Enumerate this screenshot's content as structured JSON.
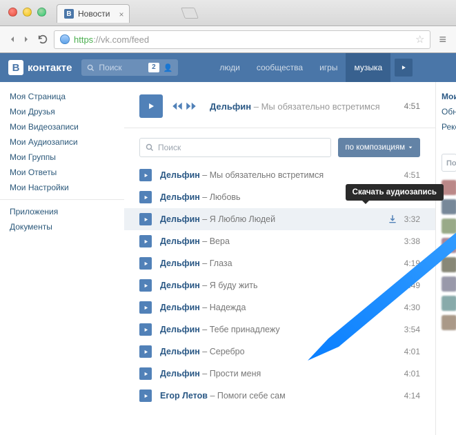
{
  "browser": {
    "tab_title": "Новости",
    "url_https": "https",
    "url_host": "://vk.com",
    "url_path": "/feed"
  },
  "vk": {
    "logo_text": "контакте",
    "search_placeholder": "Поиск",
    "search_badge": "2",
    "nav": [
      "люди",
      "сообщества",
      "игры",
      "музыка"
    ]
  },
  "leftnav": {
    "a": [
      "Моя Страница",
      "Мои Друзья",
      "Мои Видеозаписи",
      "Мои Аудиозаписи",
      "Мои Группы",
      "Мои Ответы",
      "Мои Настройки"
    ],
    "b": [
      "Приложения",
      "Документы"
    ]
  },
  "player": {
    "artist": "Дельфин",
    "title": "Мы обязательно встретимся",
    "duration": "4:51",
    "sep": " – "
  },
  "searchrow": {
    "placeholder": "Поиск",
    "button": "по композициям"
  },
  "tooltip": "Скачать аудиозапись",
  "rightpanel": {
    "tabs": "Мои ау",
    "l1": "Обновл",
    "l2": "Рекоме",
    "search": "Поиск"
  },
  "tracks": [
    {
      "artist": "Дельфин",
      "title": "Мы обязательно встретимся",
      "dur": "4:51"
    },
    {
      "artist": "Дельфин",
      "title": "Любовь",
      "dur": ""
    },
    {
      "artist": "Дельфин",
      "title": "Я Люблю Людей",
      "dur": "3:32",
      "highlight": true,
      "download": true
    },
    {
      "artist": "Дельфин",
      "title": "Вера",
      "dur": "3:38"
    },
    {
      "artist": "Дельфин",
      "title": "Глаза",
      "dur": "4:19"
    },
    {
      "artist": "Дельфин",
      "title": "Я буду жить",
      "dur": "3:49"
    },
    {
      "artist": "Дельфин",
      "title": "Надежда",
      "dur": "4:30"
    },
    {
      "artist": "Дельфин",
      "title": "Тебе принадлежу",
      "dur": "3:54"
    },
    {
      "artist": "Дельфин",
      "title": "Серебро",
      "dur": "4:01"
    },
    {
      "artist": "Дельфин",
      "title": "Прости меня",
      "dur": "4:01"
    },
    {
      "artist": "Егор Летов",
      "title": "Помоги себе сам",
      "dur": "4:14"
    }
  ]
}
